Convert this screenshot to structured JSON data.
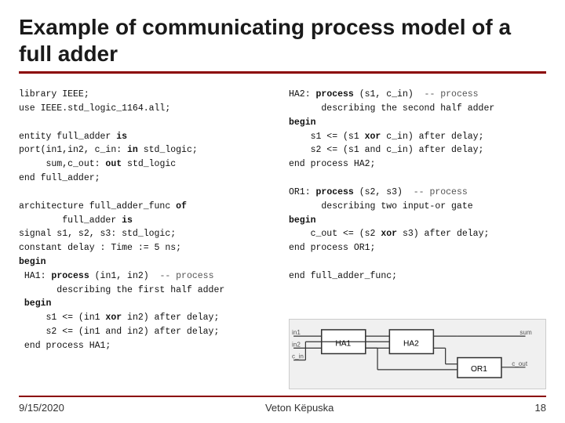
{
  "title": "Example of communicating process model of a full adder",
  "left_code": [
    "library IEEE;",
    "use IEEE.std_logic_1164.all;",
    "",
    "entity full_adder is",
    "port(in1,in2, c_in: in std_logic;",
    "     sum,c_out: out std_logic",
    "end full_adder;",
    "",
    "architecture full_adder_func of",
    "        full_adder is",
    "signal s1, s2, s3: std_logic;",
    "constant delay : Time := 5 ns;",
    "begin",
    " HA1: process (in1, in2)  -- process",
    "       describing the first half adder",
    " begin",
    "     s1 <= (in1 xor in2) after delay;",
    "     s2 <= (in1 and in2) after delay;",
    " end process HA1;"
  ],
  "right_code_top": [
    "HA2: process (s1, c_in)  -- process",
    "      describing the second half adder",
    "begin",
    "    s1 <= (s1 xor c_in) after delay;",
    "    s2 <= (s1 and c_in) after delay;",
    "end process HA2;",
    "",
    "OR1: process (s2, s3)  -- process",
    "      describing two input-or gate",
    "begin",
    "    c_out <= (s2 xor s3) after delay;",
    "end process OR1;",
    "",
    "end full_adder_func;"
  ],
  "footer": {
    "date": "9/15/2020",
    "presenter": "Veton Këpuska",
    "page": "18"
  },
  "diagram": {
    "labels": [
      "HA1",
      "HA2",
      "OR1"
    ]
  }
}
